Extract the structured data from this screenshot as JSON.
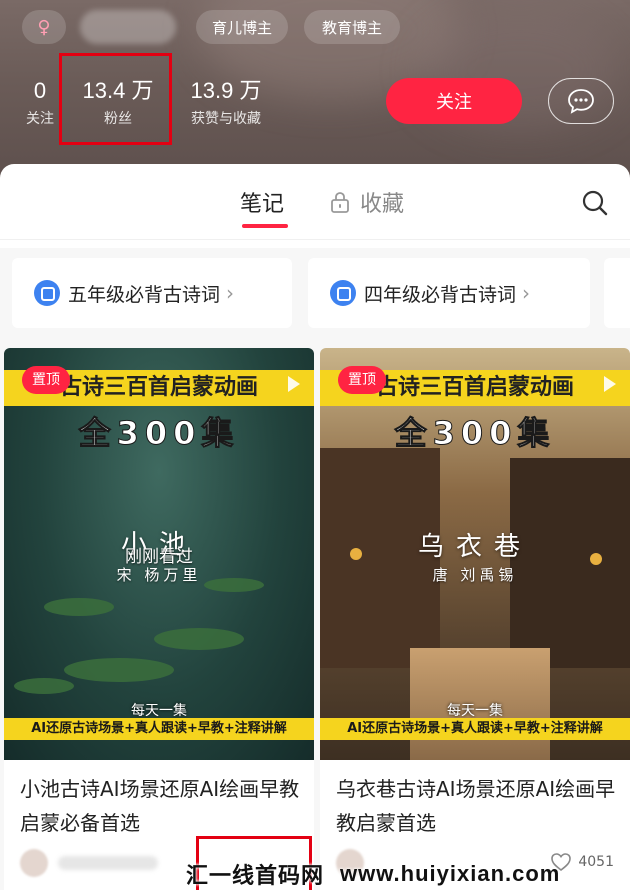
{
  "profile": {
    "gender_symbol": "♀",
    "tags": [
      "育儿博主",
      "教育博主"
    ],
    "stats": [
      {
        "value": "0",
        "label": "关注"
      },
      {
        "value": "13.4 万",
        "label": "粉丝"
      },
      {
        "value": "13.9 万",
        "label": "获赞与收藏"
      }
    ],
    "follow_label": "关注"
  },
  "tabs": {
    "notes": "笔记",
    "collect": "收藏"
  },
  "collections": [
    {
      "label": "五年级必背古诗词"
    },
    {
      "label": "四年级必背古诗词"
    }
  ],
  "cards": [
    {
      "pin": "置顶",
      "banner": "古诗三百首启蒙动画",
      "episodes": "全300集",
      "poem_title": "小池",
      "poem_author": "宋  杨万里",
      "overlay": "刚刚看过",
      "daily": "每天一集",
      "strip": "AI还原古诗场景+真人跟读+早教+注释讲解",
      "title": "小池古诗AI场景还原AI绘画早教启蒙必备首选"
    },
    {
      "pin": "置顶",
      "banner": "古诗三百首启蒙动画",
      "episodes": "全300集",
      "poem_title": "乌衣巷",
      "poem_author": "唐  刘禹锡",
      "daily": "每天一集",
      "strip": "AI还原古诗场景+真人跟读+早教+注释讲解",
      "title": "乌衣巷古诗AI场景还原AI绘画早教启蒙首选",
      "likes": "4051"
    }
  ],
  "watermark": {
    "cn": "汇一线首码网",
    "url": "www.huiyixian.com"
  },
  "colors": {
    "accent": "#ff2442",
    "highlight_box": "#e30012",
    "banner_yellow": "#f5d41e"
  }
}
